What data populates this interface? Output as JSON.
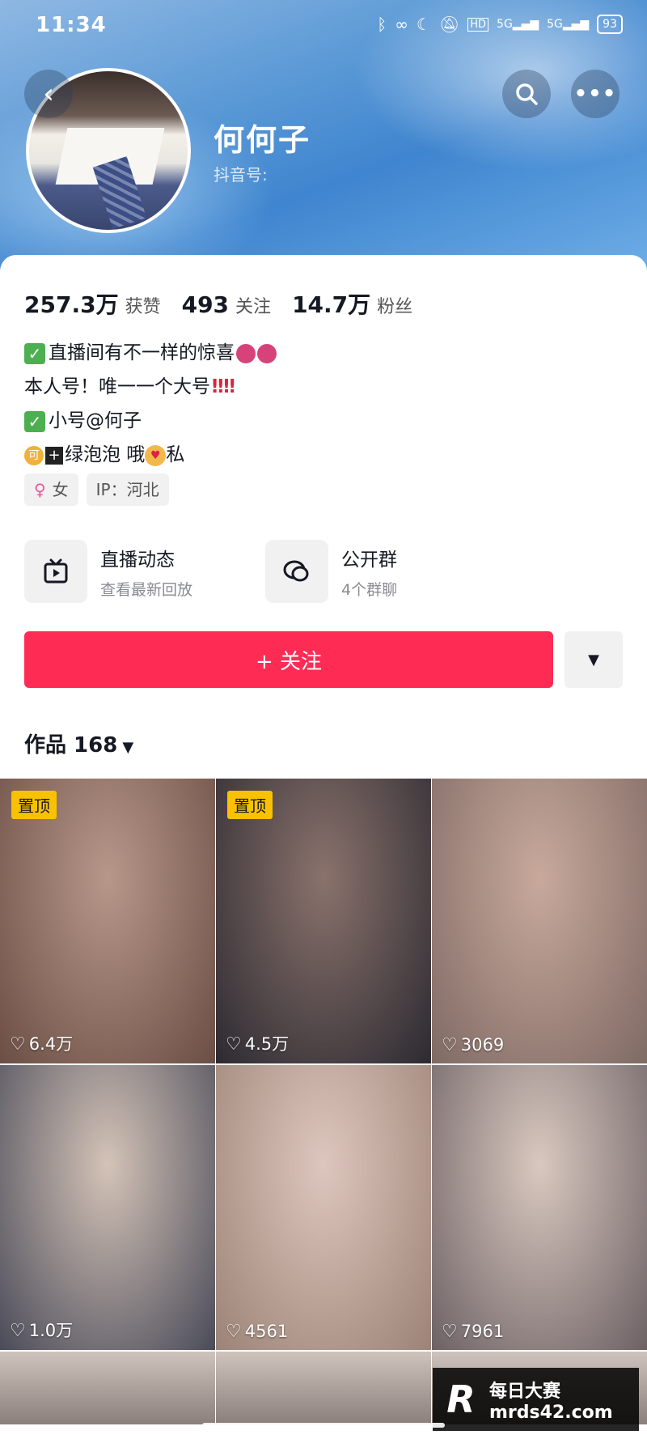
{
  "status": {
    "time": "11:34",
    "battery": "93"
  },
  "profile": {
    "name": "何何子",
    "douyin_id_label": "抖音号:",
    "stats": [
      {
        "value": "257.3万",
        "label": "获赞"
      },
      {
        "value": "493",
        "label": "关注"
      },
      {
        "value": "14.7万",
        "label": "粉丝"
      }
    ],
    "bio": {
      "line1": "直播间有不一样的惊喜",
      "line2": "本人号！唯一一个大号",
      "line3": "小号@何子",
      "line4a": "绿泡泡 哦",
      "line4b": "私"
    },
    "tags": {
      "gender": "女",
      "ip": "IP：河北"
    }
  },
  "features": [
    {
      "title": "直播动态",
      "subtitle": "查看最新回放"
    },
    {
      "title": "公开群",
      "subtitle": "4个群聊"
    }
  ],
  "follow_button": "+ 关注",
  "works_tab": "作品 168",
  "pin_label": "置顶",
  "videos": [
    {
      "likes": "6.4万",
      "pinned": true,
      "colors": [
        "#b7978a",
        "#6b4e44"
      ]
    },
    {
      "likes": "4.5万",
      "pinned": true,
      "colors": [
        "#8a726c",
        "#2c2a31"
      ]
    },
    {
      "likes": "3069",
      "pinned": false,
      "colors": [
        "#c8a99c",
        "#7f6a64"
      ]
    },
    {
      "likes": "1.0万",
      "pinned": false,
      "colors": [
        "#d4c3b7",
        "#4a4b59"
      ]
    },
    {
      "likes": "4561",
      "pinned": false,
      "colors": [
        "#ddc6bd",
        "#9c8377"
      ]
    },
    {
      "likes": "7961",
      "pinned": false,
      "colors": [
        "#d9c8bf",
        "#6c6164"
      ]
    }
  ],
  "watermark": {
    "logo": "R",
    "name": "每日大赛",
    "url": "mrds42.com"
  }
}
